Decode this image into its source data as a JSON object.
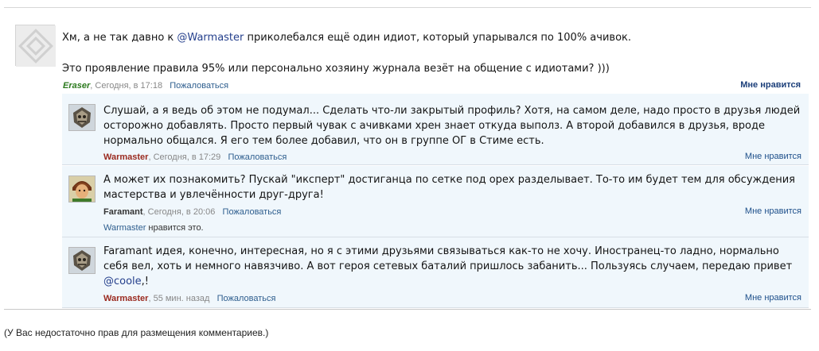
{
  "comments": [
    {
      "author": "Eraser",
      "time": "Сегодня, в 17:18",
      "report": "Пожаловаться",
      "like": "Мне нравится",
      "line1_pre": "Хм, а не так давно к ",
      "line1_mention": "@Warmaster",
      "line1_post": " приколебался ещё один идиот, который упарывался по 100% ачивок.",
      "line2": "Это проявление правила 95% или персонально хозяину журнала везёт на общение с идиотами? )))"
    },
    {
      "author": "Warmaster",
      "time": "Сегодня, в 17:29",
      "report": "Пожаловаться",
      "like": "Мне нравится",
      "line1": "Слушай, а я ведь об этом не подумал... Сделать что-ли закрытый профиль? Хотя, на самом деле, надо просто в друзья людей",
      "line2": "осторожно добавлять. Просто первый чувак с ачивками хрен знает откуда выполз. А второй добавился в друзья, вроде",
      "line3": "нормально общался. Я его тем более добавил, что он в группе ОГ в Стиме есть."
    },
    {
      "author": "Faramant",
      "time": "Сегодня, в 20:06",
      "report": "Пожаловаться",
      "like": "Мне нравится",
      "line1": "А может их познакомить? Пускай \"иксперт\" достиганца по сетке под орех разделывает. То-то им будет тем для обсуждения",
      "line2": "мастерства и увлечённости друг-друга!",
      "likes_who": "Warmaster",
      "likes_suffix": " нравится это."
    },
    {
      "author": "Warmaster",
      "time": "55 мин. назад",
      "report": "Пожаловаться",
      "like": "Мне нравится",
      "line1": "Faramant идея, конечно, интересная, но я с этими друзьями связываться как-то не хочу. Иностранец-то ладно, нормально",
      "line2": "себя вел, хоть и немного навязчиво. А вот героя сетевых баталий пришлось забанить... Пользуясь случаем, передаю привет",
      "line3_mention": "@coole",
      "line3_post": ",!"
    }
  ],
  "footer": {
    "no_rights": "(У Вас недостаточно прав для размещения комментариев.)"
  },
  "colors": {
    "reply_bg": "#f0f7fc",
    "author_green": "#2b7a1d",
    "author_red": "#9a2a1f",
    "link_blue": "#2e5e8e"
  },
  "icons": [
    "default-avatar-icon",
    "warmaster-avatar-icon",
    "faramant-avatar-icon"
  ]
}
